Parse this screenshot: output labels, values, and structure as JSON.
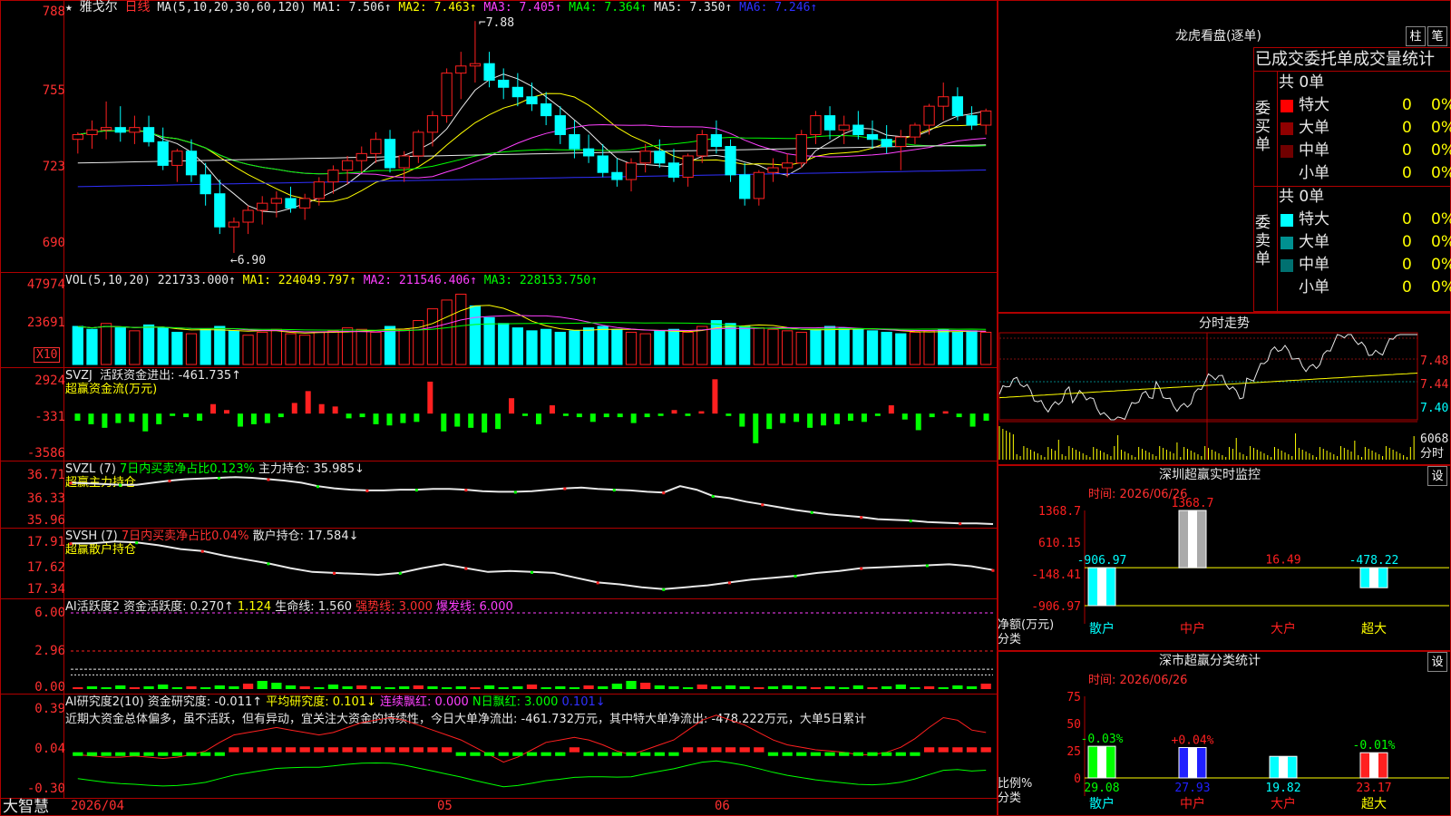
{
  "stock": {
    "name": "雅戈尔",
    "period": "日线",
    "ma_header": "MA(5,10,20,30,60,120)",
    "ma": [
      {
        "label": "MA1:",
        "value": "7.506↑",
        "color": "#e8e8e8"
      },
      {
        "label": "MA2:",
        "value": "7.463↑",
        "color": "#ffff00"
      },
      {
        "label": "MA3:",
        "value": "7.405↑",
        "color": "#ff40ff"
      },
      {
        "label": "MA4:",
        "value": "7.364↑",
        "color": "#00ff00"
      },
      {
        "label": "MA5:",
        "value": "7.350↑",
        "color": "#e8e8e8"
      },
      {
        "label": "MA6:",
        "value": "7.246↑",
        "color": "#3030ff"
      }
    ],
    "high_note": "7.88",
    "low_note": "←6.90"
  },
  "panels": {
    "vol": {
      "header": "VOL(5,10,20)",
      "value": "221733.000↑",
      "ma1": "MA1: 224049.797↑",
      "ma2": "MA2: 211546.406↑",
      "ma3": "MA3: 228153.750↑",
      "unit_badge": "X10"
    },
    "svzj": {
      "header": "SVZJ",
      "label": "活跃资金进出: -461.735↑",
      "sub": "超赢资金流(万元)"
    },
    "svzl": {
      "header": "SVZL (7)",
      "label1": "7日内买卖净占比0.123%",
      "label2": "主力持仓: 35.985↓",
      "sub": "超赢主力持仓"
    },
    "svsh": {
      "header": "SVSH (7)",
      "label1": "7日内买卖净占比0.04%",
      "label2": "散户持仓: 17.584↓",
      "sub": "超赢散户持仓"
    },
    "ai1": {
      "header": "AI活跃度2",
      "a": "资金活跃度: 0.270↑",
      "b": "1.124",
      "c": "生命线: 1.560",
      "d": "强势线: 3.000",
      "e": "爆发线: 6.000"
    },
    "ai2": {
      "header": "AI研究度2(10)",
      "a": "资金研究度: -0.011↑",
      "b": "平均研究度: 0.101↓",
      "c": "连续飘红: 0.000",
      "d": "N日飘红: 3.000",
      "e": "0.101↓",
      "note": "近期大资金总体偏多，虽不活跃，但有异动，宜关注大资金的持续性，今日大单净流出: -461.732万元，其中特大单净流出: -478.222万元，大单5日累计"
    }
  },
  "axes": {
    "price": [
      "788",
      "755",
      "723",
      "690"
    ],
    "vol": [
      "47974",
      "23691"
    ],
    "svzj": [
      "2924",
      "-331",
      "-3586"
    ],
    "svzl": [
      "36.71",
      "36.33",
      "35.96"
    ],
    "svsh": [
      "17.91",
      "17.62",
      "17.34"
    ],
    "ai1": [
      "6.00",
      "2.96",
      "0.00"
    ],
    "ai2": [
      "0.39",
      "0.04",
      "-0.30"
    ],
    "dates": [
      "2026/04",
      "05",
      "06"
    ]
  },
  "footer": {
    "brand": "大智慧"
  },
  "right": {
    "lhb_title": "龙虎看盘(逐单)",
    "btn1": "柱",
    "btn2": "笔",
    "stat_title": "已成交委托单成交量统计",
    "buy_side": "委买单",
    "sell_side": "委卖单",
    "buy_total": "共 0单",
    "sell_total": "共 0单",
    "buy_rows": [
      {
        "name": "特大",
        "qty": "0",
        "pct": "0%",
        "color": "#ff0000"
      },
      {
        "name": "大单",
        "qty": "0",
        "pct": "0%",
        "color": "#900000"
      },
      {
        "name": "中单",
        "qty": "0",
        "pct": "0%",
        "color": "#700000"
      },
      {
        "name": "小单",
        "qty": "0",
        "pct": "0%",
        "color": ""
      }
    ],
    "sell_rows": [
      {
        "name": "特大",
        "qty": "0",
        "pct": "0%",
        "color": "#00ffff"
      },
      {
        "name": "大单",
        "qty": "0",
        "pct": "0%",
        "color": "#009090"
      },
      {
        "name": "中单",
        "qty": "0",
        "pct": "0%",
        "color": "#007070"
      },
      {
        "name": "小单",
        "qty": "0",
        "pct": "0%",
        "color": ""
      }
    ],
    "fenshi_title": "分时走势",
    "fenshi_axis": [
      "7.48",
      "7.44",
      "7.40",
      "6068",
      "分时"
    ],
    "sz_monitor_title": "深圳超赢实时监控",
    "sz_monitor_btn": "设",
    "sz_class_title": "深市超赢分类统计",
    "sz_class_btn": "设",
    "date_label": "时间: 2026/06/26",
    "net_label": "净额(万元)",
    "class_label": "分类",
    "ratio_label": "比例%",
    "categories": [
      "散户",
      "中户",
      "大户",
      "超大"
    ],
    "monitor_axis": [
      "1368.7",
      "610.15",
      "-148.41",
      "-906.97"
    ],
    "class_axis": [
      "75",
      "50",
      "25",
      "0"
    ]
  },
  "chart_data": [
    {
      "type": "candlestick",
      "title": "雅戈尔 日线",
      "ylim": [
        6.85,
        7.9
      ],
      "x": [
        "2026/04",
        "05",
        "06"
      ],
      "ohlc": [
        [
          7.38,
          7.41,
          7.32,
          7.4
        ],
        [
          7.4,
          7.46,
          7.34,
          7.42
        ],
        [
          7.42,
          7.54,
          7.38,
          7.43
        ],
        [
          7.43,
          7.52,
          7.37,
          7.41
        ],
        [
          7.41,
          7.48,
          7.36,
          7.43
        ],
        [
          7.43,
          7.48,
          7.35,
          7.37
        ],
        [
          7.37,
          7.43,
          7.25,
          7.27
        ],
        [
          7.27,
          7.34,
          7.2,
          7.33
        ],
        [
          7.33,
          7.38,
          7.2,
          7.23
        ],
        [
          7.23,
          7.28,
          7.1,
          7.15
        ],
        [
          7.15,
          7.21,
          6.98,
          7.01
        ],
        [
          7.01,
          7.05,
          6.9,
          7.03
        ],
        [
          7.03,
          7.1,
          6.98,
          7.08
        ],
        [
          7.08,
          7.14,
          7.02,
          7.11
        ],
        [
          7.11,
          7.16,
          7.05,
          7.13
        ],
        [
          7.13,
          7.18,
          7.07,
          7.09
        ],
        [
          7.09,
          7.15,
          7.04,
          7.13
        ],
        [
          7.13,
          7.22,
          7.1,
          7.2
        ],
        [
          7.2,
          7.27,
          7.15,
          7.25
        ],
        [
          7.25,
          7.31,
          7.19,
          7.29
        ],
        [
          7.29,
          7.35,
          7.24,
          7.32
        ],
        [
          7.32,
          7.41,
          7.28,
          7.38
        ],
        [
          7.38,
          7.42,
          7.24,
          7.26
        ],
        [
          7.26,
          7.33,
          7.2,
          7.31
        ],
        [
          7.31,
          7.42,
          7.28,
          7.41
        ],
        [
          7.41,
          7.5,
          7.35,
          7.48
        ],
        [
          7.48,
          7.68,
          7.45,
          7.66
        ],
        [
          7.66,
          7.75,
          7.55,
          7.69
        ],
        [
          7.69,
          7.88,
          7.62,
          7.7
        ],
        [
          7.7,
          7.75,
          7.6,
          7.63
        ],
        [
          7.63,
          7.68,
          7.55,
          7.6
        ],
        [
          7.6,
          7.66,
          7.52,
          7.56
        ],
        [
          7.56,
          7.62,
          7.5,
          7.53
        ],
        [
          7.53,
          7.58,
          7.44,
          7.48
        ],
        [
          7.48,
          7.52,
          7.36,
          7.4
        ],
        [
          7.4,
          7.46,
          7.3,
          7.34
        ],
        [
          7.34,
          7.4,
          7.28,
          7.31
        ],
        [
          7.31,
          7.36,
          7.22,
          7.24
        ],
        [
          7.24,
          7.3,
          7.18,
          7.21
        ],
        [
          7.21,
          7.3,
          7.16,
          7.28
        ],
        [
          7.28,
          7.36,
          7.24,
          7.33
        ],
        [
          7.33,
          7.38,
          7.26,
          7.28
        ],
        [
          7.28,
          7.34,
          7.2,
          7.22
        ],
        [
          7.22,
          7.32,
          7.18,
          7.31
        ],
        [
          7.31,
          7.42,
          7.28,
          7.4
        ],
        [
          7.4,
          7.46,
          7.32,
          7.35
        ],
        [
          7.35,
          7.38,
          7.2,
          7.23
        ],
        [
          7.23,
          7.28,
          7.1,
          7.13
        ],
        [
          7.13,
          7.25,
          7.1,
          7.24
        ],
        [
          7.24,
          7.3,
          7.2,
          7.26
        ],
        [
          7.26,
          7.32,
          7.22,
          7.28
        ],
        [
          7.28,
          7.42,
          7.26,
          7.4
        ],
        [
          7.4,
          7.5,
          7.36,
          7.48
        ],
        [
          7.48,
          7.52,
          7.38,
          7.42
        ],
        [
          7.42,
          7.48,
          7.36,
          7.44
        ],
        [
          7.44,
          7.5,
          7.38,
          7.4
        ],
        [
          7.4,
          7.46,
          7.34,
          7.38
        ],
        [
          7.38,
          7.44,
          7.32,
          7.35
        ],
        [
          7.35,
          7.42,
          7.25,
          7.39
        ],
        [
          7.39,
          7.45,
          7.36,
          7.44
        ],
        [
          7.44,
          7.53,
          7.4,
          7.52
        ],
        [
          7.52,
          7.62,
          7.46,
          7.56
        ],
        [
          7.56,
          7.6,
          7.46,
          7.48
        ],
        [
          7.48,
          7.52,
          7.42,
          7.44
        ],
        [
          7.44,
          7.51,
          7.4,
          7.5
        ]
      ]
    },
    {
      "type": "bar",
      "title": "VOL(5,10,20)",
      "ylim": [
        0,
        52000
      ],
      "values": [
        26000,
        24000,
        28000,
        25000,
        23000,
        27000,
        25000,
        22000,
        21000,
        24000,
        26000,
        23000,
        20000,
        22000,
        24000,
        21000,
        20000,
        22000,
        23000,
        25000,
        24000,
        22000,
        26000,
        24000,
        30000,
        38000,
        44000,
        48000,
        40000,
        32000,
        28000,
        25000,
        23000,
        24000,
        22000,
        23000,
        25000,
        26000,
        24000,
        22000,
        21000,
        23000,
        24000,
        22000,
        26000,
        30000,
        28000,
        26000,
        25000,
        24000,
        23000,
        22000,
        24000,
        26000,
        25000,
        24000,
        23000,
        22000,
        21000,
        22000,
        23000,
        24000,
        22000,
        23000,
        22000
      ],
      "colors": [
        "c",
        "c",
        "r",
        "c",
        "r",
        "c",
        "c",
        "c",
        "r",
        "c",
        "c",
        "c",
        "r",
        "r",
        "r",
        "r",
        "r",
        "r",
        "r",
        "r",
        "r",
        "r",
        "c",
        "r",
        "r",
        "r",
        "r",
        "r",
        "c",
        "c",
        "c",
        "c",
        "c",
        "c",
        "c",
        "c",
        "c",
        "c",
        "c",
        "r",
        "r",
        "c",
        "c",
        "r",
        "r",
        "c",
        "c",
        "c",
        "r",
        "r",
        "r",
        "r",
        "c",
        "c",
        "c",
        "c",
        "c",
        "c",
        "c",
        "r",
        "r",
        "c",
        "c",
        "c",
        "r"
      ]
    },
    {
      "type": "bar",
      "title": "SVZJ",
      "ylim": [
        -3586,
        2924
      ],
      "values": [
        -600,
        -900,
        -1200,
        -800,
        -700,
        -1500,
        -900,
        -200,
        -300,
        -600,
        800,
        300,
        -1100,
        -900,
        -800,
        -300,
        900,
        1900,
        800,
        600,
        -400,
        -300,
        -900,
        -1000,
        -800,
        -700,
        2700,
        -1500,
        -1100,
        -1200,
        -1600,
        -1300,
        1300,
        -200,
        -900,
        700,
        -200,
        -300,
        -700,
        -300,
        -300,
        -800,
        -300,
        -200,
        300,
        -200,
        200,
        2900,
        -200,
        -1100,
        -2500,
        -1300,
        -800,
        -700,
        -1200,
        -1000,
        -900,
        -600,
        -700,
        -200,
        700,
        -500,
        -1400,
        -300,
        200,
        -300,
        -1100,
        -600
      ],
      "series": [
        {
          "values": []
        }
      ]
    },
    {
      "type": "line",
      "title": "SVZL (7)",
      "ylim": [
        35.96,
        36.71
      ],
      "values": [
        36.55,
        36.54,
        36.53,
        36.52,
        36.52,
        36.55,
        36.58,
        36.6,
        36.61,
        36.62,
        36.63,
        36.62,
        36.6,
        36.58,
        36.55,
        36.5,
        36.47,
        36.45,
        36.44,
        36.44,
        36.45,
        36.45,
        36.46,
        36.46,
        36.45,
        36.43,
        36.42,
        36.42,
        36.43,
        36.45,
        36.47,
        36.48,
        36.46,
        36.45,
        36.44,
        36.42,
        36.41,
        36.5,
        36.45,
        36.36,
        36.33,
        36.28,
        36.24,
        36.2,
        36.16,
        36.13,
        36.1,
        36.08,
        36.06,
        36.03,
        36.02,
        36.01,
        35.99,
        35.98,
        35.97,
        35.97,
        35.96
      ]
    },
    {
      "type": "line",
      "title": "SVSH (7)",
      "ylim": [
        17.34,
        17.91
      ],
      "values": [
        17.86,
        17.86,
        17.88,
        17.87,
        17.84,
        17.8,
        17.78,
        17.73,
        17.69,
        17.65,
        17.6,
        17.56,
        17.55,
        17.54,
        17.53,
        17.55,
        17.6,
        17.64,
        17.6,
        17.56,
        17.57,
        17.56,
        17.55,
        17.5,
        17.45,
        17.43,
        17.4,
        17.38,
        17.4,
        17.42,
        17.45,
        17.48,
        17.5,
        17.52,
        17.55,
        17.57,
        17.6,
        17.61,
        17.62,
        17.63,
        17.64,
        17.62,
        17.58
      ]
    },
    {
      "type": "bar",
      "title": "AI活跃度2",
      "ylim": [
        0,
        6.0
      ],
      "lines": {
        "life": 1.56,
        "strong": 3.0,
        "burst": 6.0
      }
    },
    {
      "type": "bar",
      "title": "AI研究度2(10)",
      "ylim": [
        -0.3,
        0.39
      ]
    },
    {
      "type": "bar",
      "title": "深圳超赢实时监控",
      "categories": [
        "散户",
        "中户",
        "大户",
        "超大"
      ],
      "values": [
        -906.97,
        1368.7,
        16.49,
        -478.22
      ],
      "ylim": [
        -906.97,
        1368.7
      ]
    },
    {
      "type": "bar",
      "title": "深市超赢分类统计",
      "categories": [
        "散户",
        "中户",
        "大户",
        "超大"
      ],
      "values": [
        29.08,
        27.93,
        19.82,
        23.17
      ],
      "changes": [
        "-0.03%",
        "+0.04%",
        "",
        "-0.01%"
      ],
      "ylim": [
        0,
        75
      ]
    }
  ]
}
